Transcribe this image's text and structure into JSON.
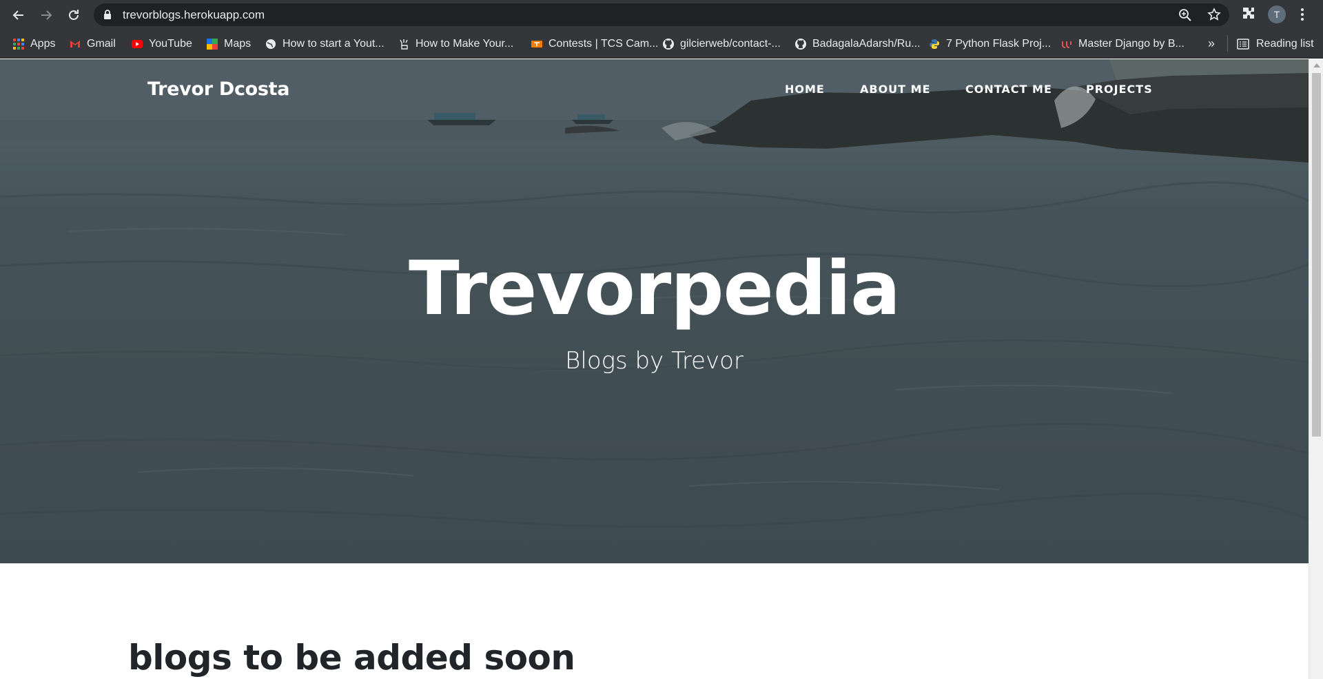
{
  "browser": {
    "url": "trevorblogs.herokuapp.com",
    "profile_initial": "T",
    "bookmarks": [
      {
        "label": "Apps",
        "icon": "apps-grid-icon"
      },
      {
        "label": "Gmail",
        "icon": "gmail-icon"
      },
      {
        "label": "YouTube",
        "icon": "youtube-icon"
      },
      {
        "label": "Maps",
        "icon": "maps-icon"
      },
      {
        "label": "How to start a Yout...",
        "icon": "globe-icon"
      },
      {
        "label": "How to Make Your...",
        "icon": "hand-icon"
      },
      {
        "label": "Contests | TCS Cam...",
        "icon": "tcs-icon"
      },
      {
        "label": "gilcierweb/contact-...",
        "icon": "github-icon"
      },
      {
        "label": "BadagalaAdarsh/Ru...",
        "icon": "github-icon"
      },
      {
        "label": "7 Python Flask Proj...",
        "icon": "python-icon"
      },
      {
        "label": "Master Django by B...",
        "icon": "udemy-icon"
      }
    ],
    "more_bookmarks": "»",
    "reading_list": "Reading list"
  },
  "site": {
    "brand": "Trevor Dcosta",
    "nav": [
      "HOME",
      "ABOUT ME",
      "CONTACT ME",
      "PROJECTS"
    ],
    "hero_title": "Trevorpedia",
    "hero_subtitle": "Blogs by Trevor",
    "content_heading": "blogs to be added soon"
  },
  "colors": {
    "chrome_bg": "#35363a",
    "omnibox_bg": "#202124",
    "hero_overlay": "#212529",
    "heading_text": "#212529"
  }
}
